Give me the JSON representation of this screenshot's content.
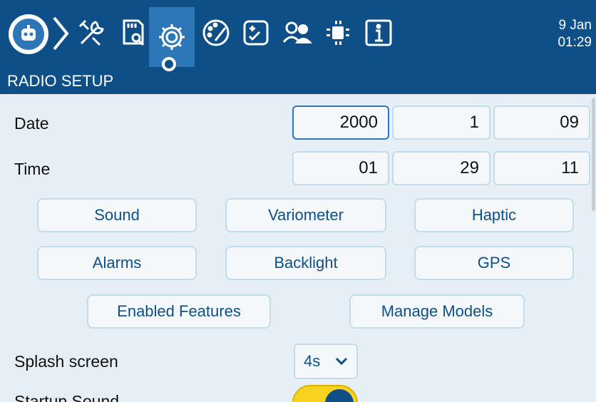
{
  "topbar": {
    "tabs": [
      {
        "name": "tools-icon"
      },
      {
        "name": "sd-card-icon"
      },
      {
        "name": "gear-icon"
      },
      {
        "name": "theme-icon"
      },
      {
        "name": "checklist-icon"
      },
      {
        "name": "trainer-icon"
      },
      {
        "name": "hardware-icon"
      },
      {
        "name": "info-icon"
      }
    ],
    "clock": {
      "date": "9 Jan",
      "time": "01:29"
    }
  },
  "page": {
    "title": "RADIO SETUP"
  },
  "date": {
    "label": "Date",
    "year": "2000",
    "month": "1",
    "day": "09"
  },
  "time": {
    "label": "Time",
    "hour": "01",
    "minute": "29",
    "second": "11"
  },
  "buttons": {
    "sound": "Sound",
    "variometer": "Variometer",
    "haptic": "Haptic",
    "alarms": "Alarms",
    "backlight": "Backlight",
    "gps": "GPS",
    "enabled_features": "Enabled Features",
    "manage_models": "Manage Models"
  },
  "splash": {
    "label": "Splash screen",
    "value": "4s"
  },
  "startup_sound": {
    "label": "Startup Sound",
    "enabled": true
  },
  "colors": {
    "header": "#0f4f87",
    "active_tab": "#2d76b8",
    "background": "#e6eff5",
    "toggle_on": "#f7d21e"
  }
}
